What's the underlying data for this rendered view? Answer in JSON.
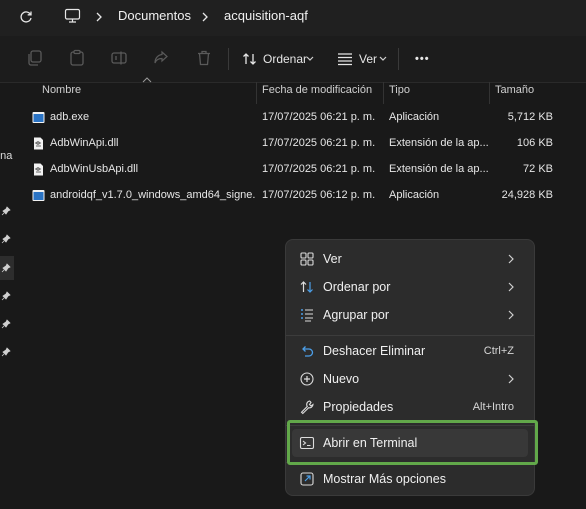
{
  "breadcrumb": {
    "items": [
      "Documentos",
      "acquisition-aqf"
    ]
  },
  "toolbar": {
    "sort_label": "Ordenar",
    "view_label": "Ver",
    "more_label": "•••"
  },
  "navpane": {
    "partial_label": "ona"
  },
  "columns": {
    "name": "Nombre",
    "date": "Fecha de modificación",
    "type": "Tipo",
    "size": "Tamaño"
  },
  "files": [
    {
      "name": "adb.exe",
      "date": "17/07/2025 06:21 p. m.",
      "type": "Aplicación",
      "size": "5,712 KB",
      "icon": "application-icon"
    },
    {
      "name": "AdbWinApi.dll",
      "date": "17/07/2025 06:21 p. m.",
      "type": "Extensión de la ap...",
      "size": "106 KB",
      "icon": "dll-file-icon"
    },
    {
      "name": "AdbWinUsbApi.dll",
      "date": "17/07/2025 06:21 p. m.",
      "type": "Extensión de la ap...",
      "size": "72 KB",
      "icon": "dll-file-icon"
    },
    {
      "name": "androidqf_v1.7.0_windows_amd64_signe...",
      "date": "17/07/2025 06:12 p. m.",
      "type": "Aplicación",
      "size": "24,928 KB",
      "icon": "application-icon"
    }
  ],
  "context_menu": {
    "items": [
      {
        "label": "Ver",
        "shortcut": "",
        "submenu": true,
        "icon": "grid-view-icon"
      },
      {
        "label": "Ordenar por",
        "shortcut": "",
        "submenu": true,
        "icon": "sort-icon"
      },
      {
        "label": "Agrupar por",
        "shortcut": "",
        "submenu": true,
        "icon": "group-list-icon"
      },
      {
        "label": "Deshacer Eliminar",
        "shortcut": "Ctrl+Z",
        "submenu": false,
        "icon": "undo-icon"
      },
      {
        "label": "Nuevo",
        "shortcut": "",
        "submenu": true,
        "icon": "new-plus-icon"
      },
      {
        "label": "Propiedades",
        "shortcut": "Alt+Intro",
        "submenu": false,
        "icon": "wrench-icon"
      },
      {
        "label": "Abrir en Terminal",
        "shortcut": "",
        "submenu": false,
        "icon": "terminal-icon"
      },
      {
        "label": "Mostrar Más opciones",
        "shortcut": "",
        "submenu": false,
        "icon": "more-options-icon"
      }
    ]
  },
  "colors": {
    "background": "#191919",
    "menu_background": "#2c2c2c",
    "highlight_border": "#62a84a",
    "accent_blue": "#4c9fe8"
  }
}
